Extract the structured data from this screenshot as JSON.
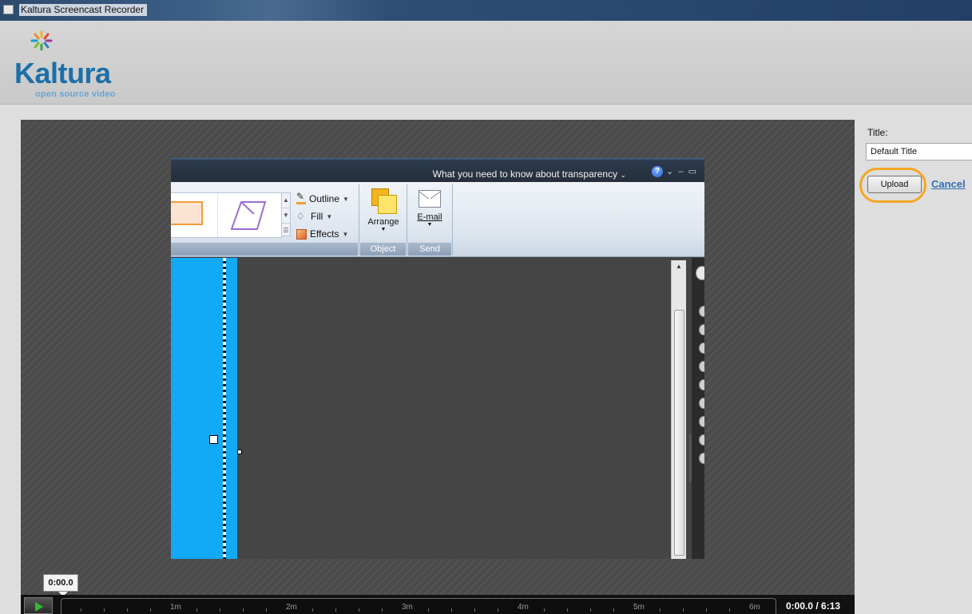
{
  "window": {
    "title": "Kaltura Screencast Recorder"
  },
  "header": {
    "logo_text": "Kaltura",
    "logo_tagline": "open source video"
  },
  "embedded_app": {
    "window_title": "What you need to know about transparency",
    "help_symbol": "?",
    "format_items": [
      {
        "label": "Outline",
        "icon": "outline-icon"
      },
      {
        "label": "Fill",
        "icon": "fill-icon"
      },
      {
        "label": "Effects",
        "icon": "effects-icon"
      }
    ],
    "arrange_label": "Arrange",
    "email_label": "E-mail",
    "group_object": "Object",
    "group_send": "Send"
  },
  "form": {
    "title_label": "Title:",
    "title_value": "Default Title",
    "upload_label": "Upload",
    "cancel_label": "Cancel"
  },
  "player": {
    "tooltip_time": "0:00.0",
    "time_display": "0:00.0 / 6:13",
    "progress_fraction": 0,
    "tick_labels": [
      "1m",
      "2m",
      "3m",
      "4m",
      "5m",
      "6m"
    ]
  },
  "colors": {
    "accent_orange": "#f5a623",
    "link_blue": "#2f6fb3",
    "brand_blue": "#1c6fa8",
    "shape_blue": "#12a9f5"
  }
}
